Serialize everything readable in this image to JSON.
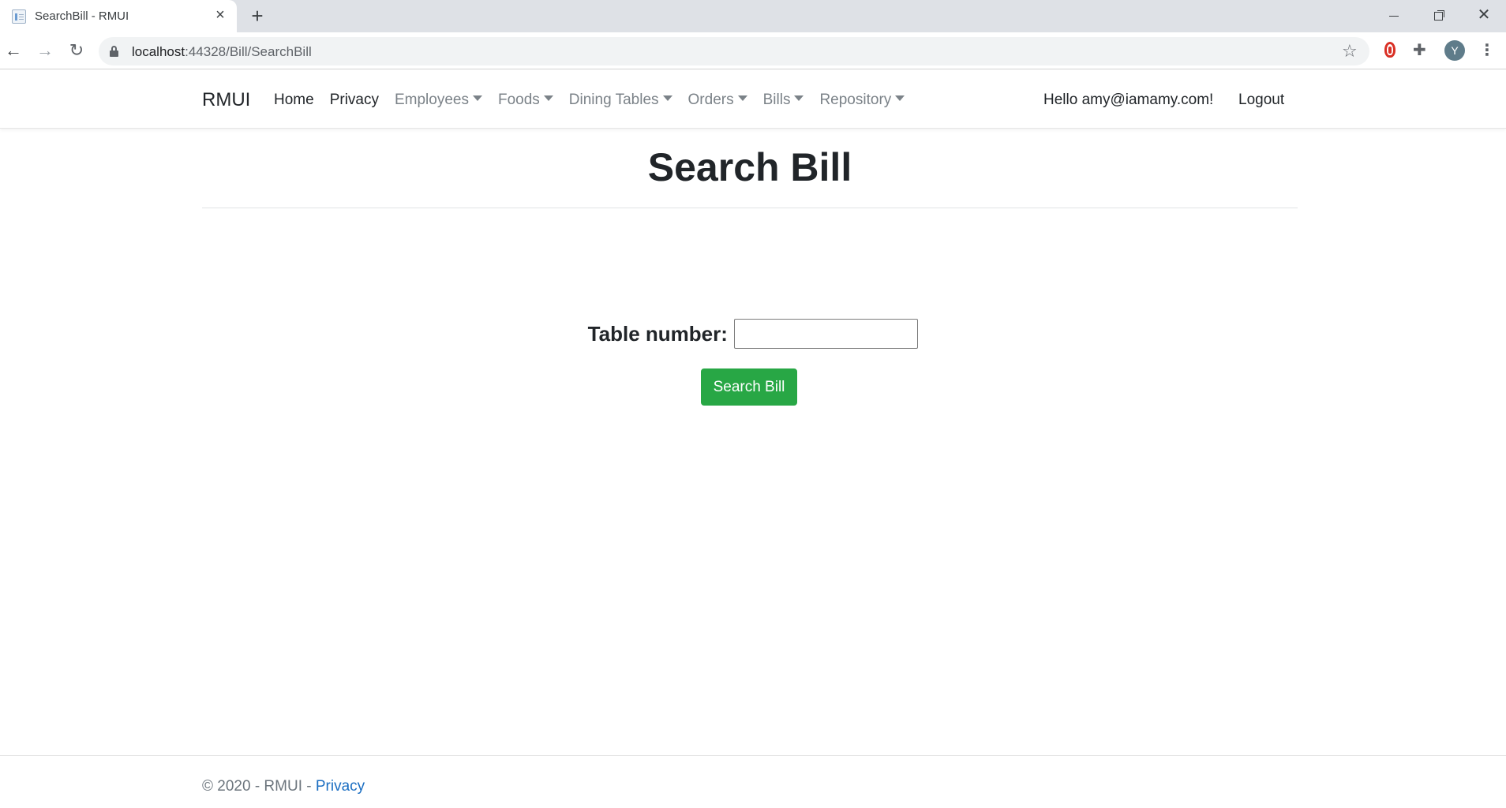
{
  "browser": {
    "tab_title": "SearchBill - RMUI",
    "tab_close": "×",
    "new_tab": "+",
    "url_host": "localhost",
    "url_path": ":44328/Bill/SearchBill",
    "profile_initial": "Y",
    "icons": [
      "favicon-icon",
      "close-icon",
      "plus-icon",
      "back-arrow-icon",
      "forward-arrow-icon",
      "reload-icon",
      "lock-icon",
      "star-icon",
      "extension-icon",
      "puzzle-icon",
      "kebab-menu-icon"
    ]
  },
  "nav": {
    "brand": "RMUI",
    "links": [
      {
        "label": "Home",
        "dropdown": false
      },
      {
        "label": "Privacy",
        "dropdown": false
      },
      {
        "label": "Employees",
        "dropdown": true
      },
      {
        "label": "Foods",
        "dropdown": true
      },
      {
        "label": "Dining Tables",
        "dropdown": true
      },
      {
        "label": "Orders",
        "dropdown": true
      },
      {
        "label": "Bills",
        "dropdown": true
      },
      {
        "label": "Repository",
        "dropdown": true
      }
    ],
    "greeting": "Hello amy@iamamy.com!",
    "logout": "Logout"
  },
  "main": {
    "title": "Search Bill",
    "table_number_label": "Table number:",
    "table_number_value": "",
    "submit_label": "Search Bill"
  },
  "footer": {
    "copyright": "© 2020 - RMUI - ",
    "privacy_link": "Privacy"
  },
  "colors": {
    "accent_button": "#28a745",
    "link": "#1b6ec2",
    "muted_nav": "#7b8288"
  }
}
